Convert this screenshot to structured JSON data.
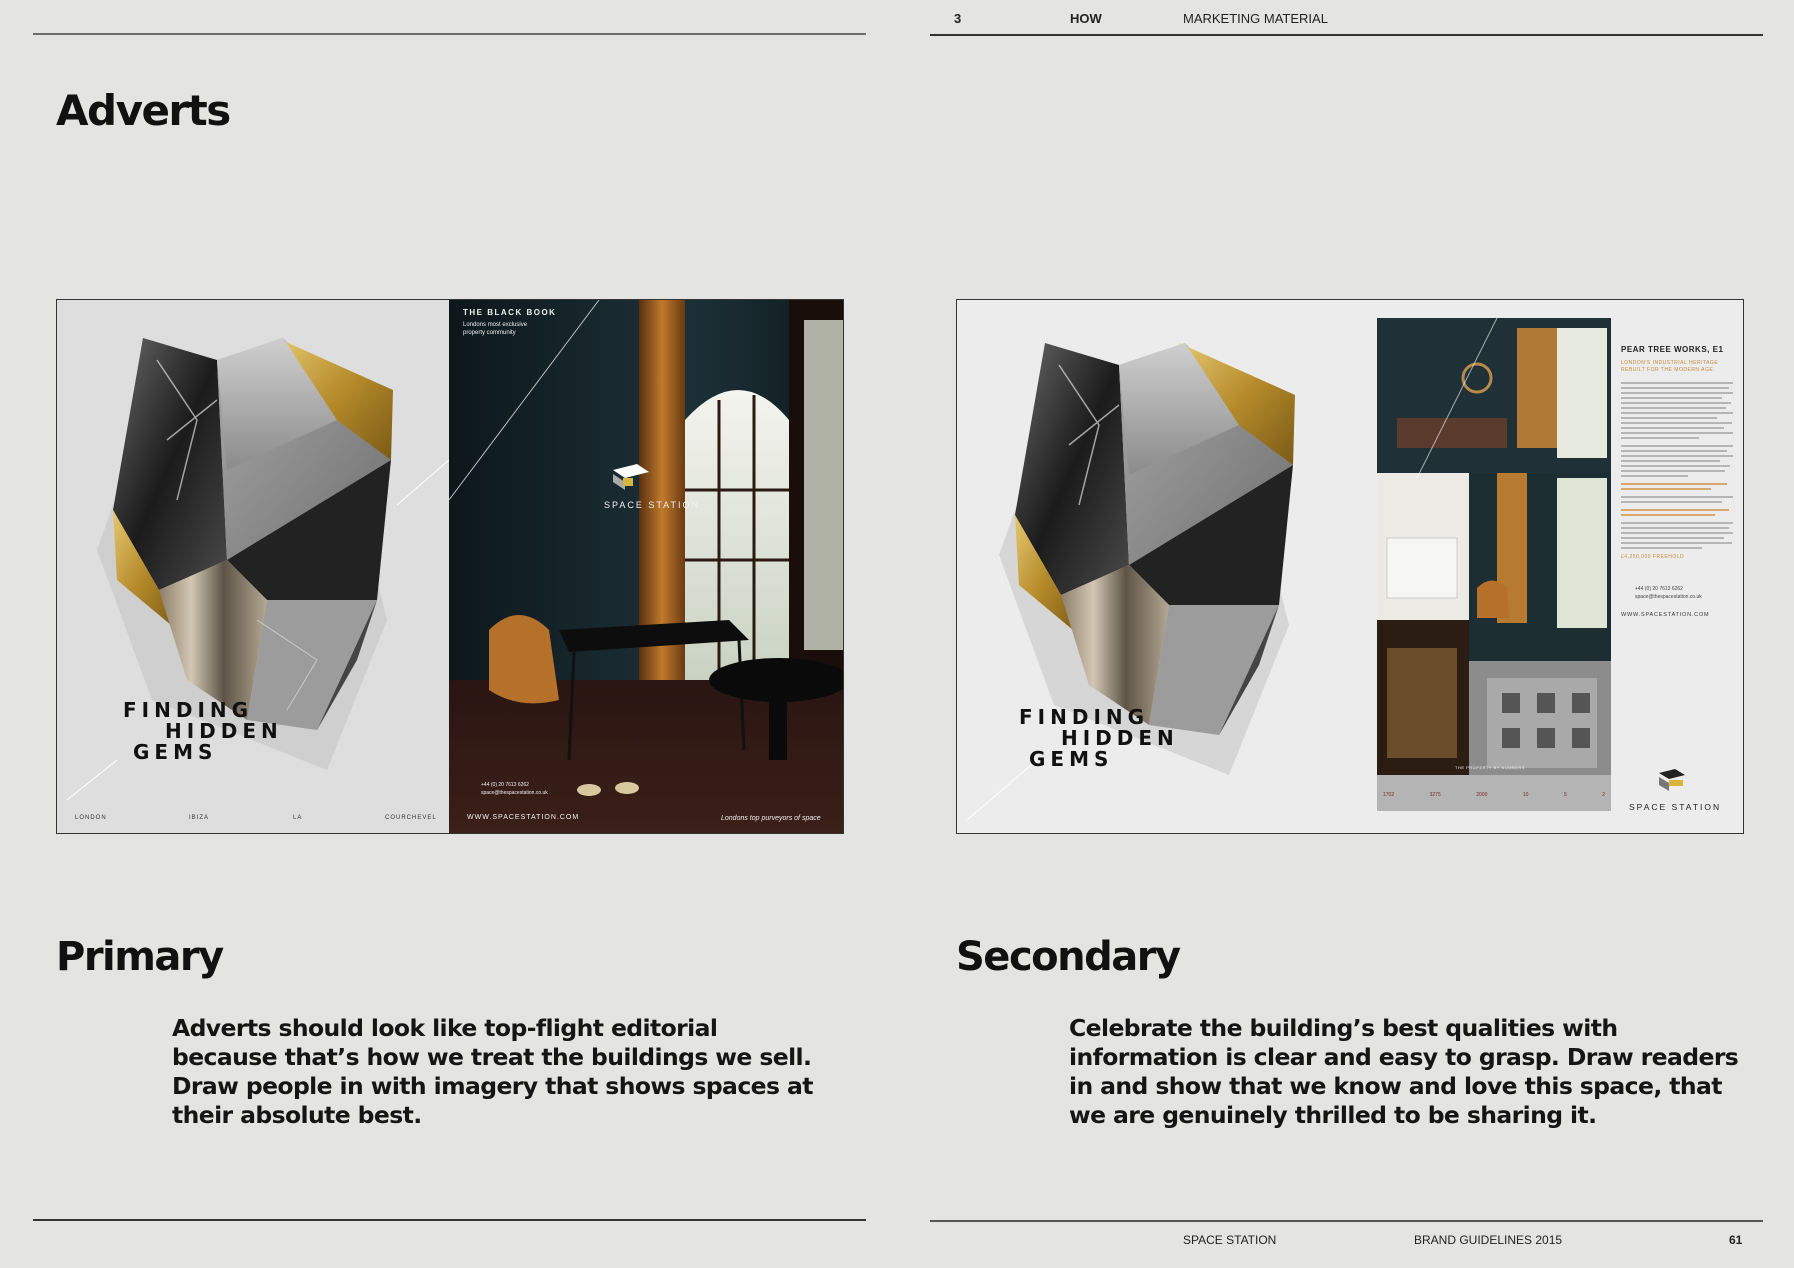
{
  "header": {
    "page_number": "3",
    "section": "HOW",
    "subsection": "MARKETING MATERIAL"
  },
  "page_title": "Adverts",
  "primary": {
    "heading": "Primary",
    "body": "Adverts should look like top-flight editorial because that’s how we treat the buildings we sell. Draw people in with imagery that shows spaces at their absolute best.",
    "advert": {
      "headline_lines": [
        "FINDING",
        "HIDDEN",
        "GEMS"
      ],
      "locations": [
        "LONDON",
        "IBIZA",
        "LA",
        "COURCHEVEL"
      ],
      "black_book_title": "THE BLACK BOOK",
      "black_book_subtitle": "Londons most exclusive property community",
      "brand": "SPACE STATION",
      "phone": "+44 (0) 20 7613 6262",
      "email": "space@thespacestation.co.uk",
      "website": "WWW.SPACESTATION.COM",
      "tagline": "Londons top purveyors of space"
    }
  },
  "secondary": {
    "heading": "Secondary",
    "body": "Celebrate the building’s best qualities with information is clear and easy to grasp. Draw readers in and show that we know and love this space, that we are genuinely thrilled to be sharing it.",
    "advert": {
      "headline_lines": [
        "FINDING",
        "HIDDEN",
        "GEMS"
      ],
      "property_title": "PEAR TREE WORKS, E1",
      "property_subtitle": "LONDON'S INDUSTRIAL HERITAGE REBUILT FOR THE MODERN AGE",
      "price": "£4,250,000 FREEHOLD",
      "phone": "+44 (0) 20 7613 6262",
      "email": "space@thespacestation.co.uk",
      "website": "WWW.SPACESTATION.COM",
      "brand": "SPACE STATION",
      "numbers_title": "THE PROPERTY BY NUMBERS",
      "numbers": [
        "1702",
        "3275",
        "2000",
        "10",
        "5",
        "2"
      ]
    }
  },
  "footer": {
    "brand": "SPACE STATION",
    "document": "BRAND GUIDELINES 2015",
    "page": "61"
  },
  "colors": {
    "background": "#e4e4e3",
    "text": "#111111",
    "rule": "#6d6d6d",
    "gold": "#c9a545",
    "accent_orange": "#c98a3c"
  }
}
